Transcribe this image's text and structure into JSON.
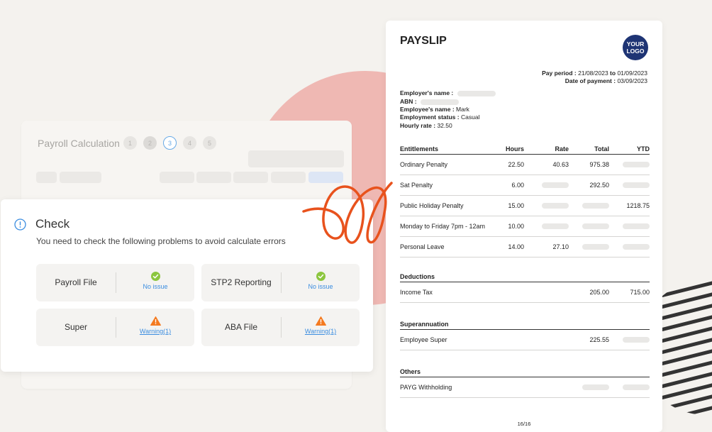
{
  "calc_panel": {
    "title": "Payroll Calculation",
    "steps": [
      "1",
      "2",
      "3",
      "4",
      "5"
    ],
    "active_step": 3
  },
  "check": {
    "title": "Check",
    "description": "You need to check the following problems to avoid calculate errors",
    "items": [
      {
        "name": "Payroll File",
        "status": "No issue",
        "type": "ok"
      },
      {
        "name": "STP2 Reporting",
        "status": "No issue",
        "type": "ok"
      },
      {
        "name": "Super",
        "status": "Warning(1)",
        "type": "warning"
      },
      {
        "name": "ABA File",
        "status": "Warning(1)",
        "type": "warning"
      }
    ],
    "colors": {
      "ok": "#8cc63f",
      "warning": "#f47a20",
      "info": "#3b8de0"
    }
  },
  "payslip": {
    "title": "PAYSLIP",
    "logo_line1": "YOUR",
    "logo_line2": "LOGO",
    "pay_period_label": "Pay period :",
    "pay_period_from": "21/08/2023",
    "pay_period_to_word": "to",
    "pay_period_to": "01/09/2023",
    "date_of_payment_label": "Date of payment :",
    "date_of_payment": "03/09/2023",
    "employer_name_label": "Employer's name :",
    "abn_label": "ABN :",
    "employee_name_label": "Employee's name :",
    "employee_name": "Mark",
    "employment_status_label": "Employment status :",
    "employment_status": "Casual",
    "hourly_rate_label": "Hourly rate :",
    "hourly_rate": "32.50",
    "entitlements": {
      "headers": [
        "Entitlements",
        "Hours",
        "Rate",
        "Total",
        "YTD"
      ],
      "rows": [
        {
          "name": "Ordinary Penalty",
          "hours": "22.50",
          "rate": "40.63",
          "total": "975.38",
          "ytd": ""
        },
        {
          "name": "Sat Penalty",
          "hours": "6.00",
          "rate": "",
          "total": "292.50",
          "ytd": ""
        },
        {
          "name": "Public Holiday Penalty",
          "hours": "15.00",
          "rate": "",
          "total": "",
          "ytd": "1218.75"
        },
        {
          "name": "Monday to Friday 7pm - 12am",
          "hours": "10.00",
          "rate": "",
          "total": "",
          "ytd": ""
        },
        {
          "name": "Personal Leave",
          "hours": "14.00",
          "rate": "27.10",
          "total": "",
          "ytd": ""
        }
      ]
    },
    "deductions": {
      "header": "Deductions",
      "rows": [
        {
          "name": "Income Tax",
          "total": "205.00",
          "ytd": "715.00"
        }
      ]
    },
    "superannuation": {
      "header": "Superannuation",
      "rows": [
        {
          "name": "Employee Super",
          "total": "225.55",
          "ytd": ""
        }
      ]
    },
    "others": {
      "header": "Others",
      "rows": [
        {
          "name": "PAYG Withholding",
          "total": "",
          "ytd": ""
        }
      ]
    },
    "page": "16/16"
  }
}
